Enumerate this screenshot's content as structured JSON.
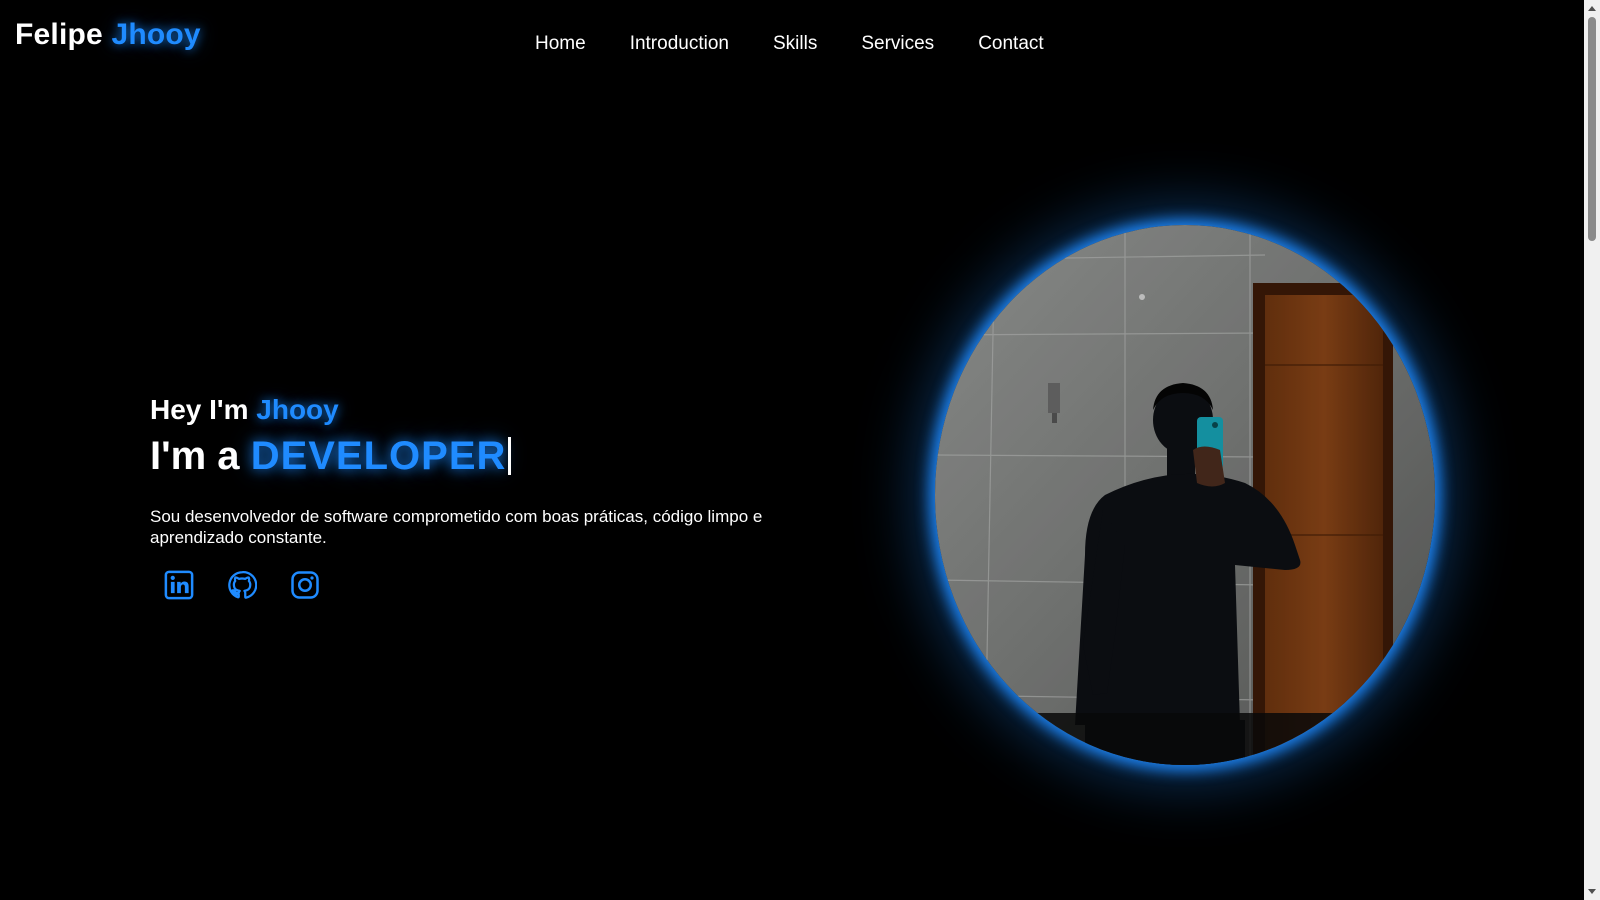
{
  "header": {
    "logo_first": "Felipe",
    "logo_accent": "Jhooy",
    "nav": [
      "Home",
      "Introduction",
      "Skills",
      "Services",
      "Contact"
    ]
  },
  "hero": {
    "greeting_prefix": "Hey I'm",
    "greeting_name": "Jhooy",
    "role_prefix": "I'm a",
    "role_word": "DEVELOPER",
    "description": "Sou desenvolvedor de software comprometido com boas práticas, código limpo e aprendizado constante."
  },
  "socials": [
    {
      "icon": "linkedin-icon"
    },
    {
      "icon": "github-icon"
    },
    {
      "icon": "instagram-icon"
    }
  ],
  "theme": {
    "accent": "#1f8bff",
    "background": "#000000",
    "text": "#ffffff"
  }
}
